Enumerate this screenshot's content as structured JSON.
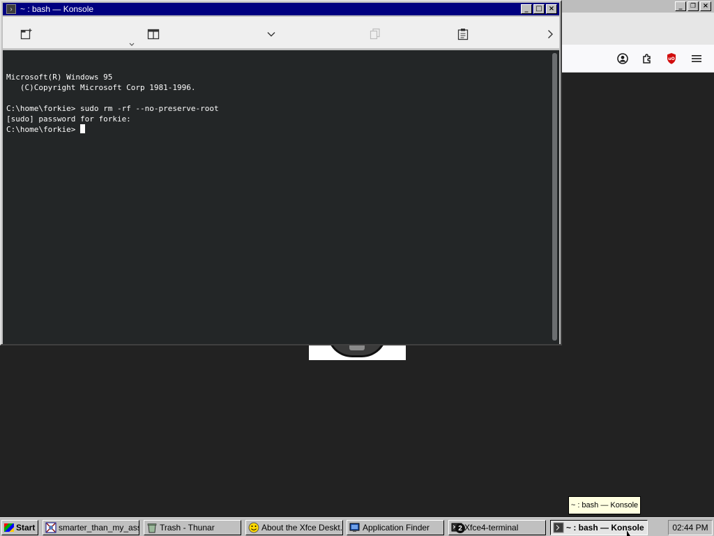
{
  "konsole": {
    "title": "~ : bash — Konsole",
    "terminal_lines": [
      "Microsoft(R) Windows 95",
      "   (C)Copyright Microsoft Corp 1981-1996.",
      "",
      "C:\\home\\forkie> sudo rm -rf --no-preserve-root",
      "[sudo] password for forkie:"
    ],
    "prompt": "C:\\home\\forkie> ",
    "icons": {
      "new_tab": "new-tab-icon",
      "split_view": "split-view-icon",
      "dropdown": "chevron-down-icon",
      "copy": "copy-icon",
      "paste": "paste-icon",
      "more": "chevron-right-icon"
    }
  },
  "window_buttons": {
    "minimize": "_",
    "maximize": "□",
    "close": "×"
  },
  "tooltip": "~ : bash — Konsole",
  "taskbar": {
    "start": "Start",
    "tasks": [
      {
        "label": "smarter_than_my_ass...",
        "icon": "image-icon"
      },
      {
        "label": "Trash - Thunar",
        "icon": "trash-icon"
      },
      {
        "label": "About the Xfce Deskt...",
        "icon": "smiley-icon"
      },
      {
        "label": "Application Finder",
        "icon": "app-finder-icon"
      },
      {
        "label": "Xfce4-terminal",
        "icon": "terminal-icon",
        "badge": "2"
      },
      {
        "label": "~ : bash — Konsole",
        "icon": "konsole-icon"
      }
    ],
    "clock": "02:44 PM"
  },
  "colors": {
    "titlebar_active": "#000080",
    "terminal_bg": "#232627",
    "terminal_fg": "#fcfcfc",
    "desktop_bg": "#222222",
    "ublock_red": "#d10d0d"
  }
}
